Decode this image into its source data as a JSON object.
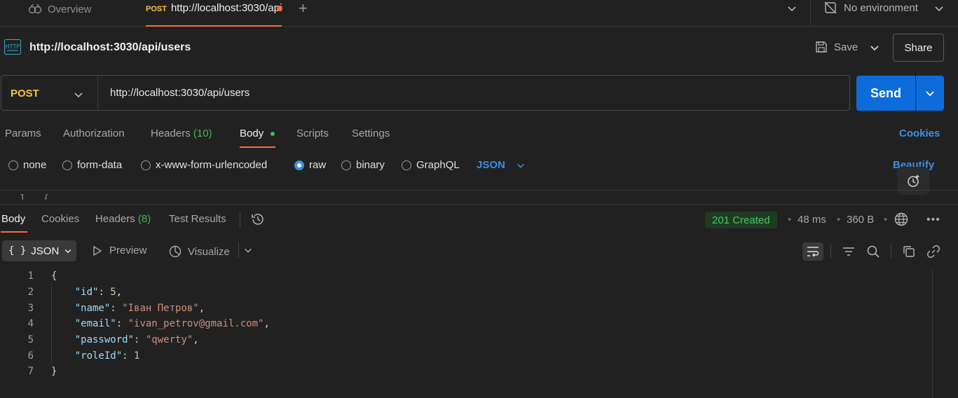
{
  "tabs": {
    "overview_label": "Overview",
    "active": {
      "method": "POST",
      "label": "http://localhost:3030/api/users"
    },
    "environment": "No environment"
  },
  "request": {
    "title": "http://localhost:3030/api/users",
    "save_label": "Save",
    "share_label": "Share",
    "method": "POST",
    "url": "http://localhost:3030/api/users",
    "send_label": "Send",
    "tabs": [
      {
        "label": "Params"
      },
      {
        "label": "Authorization"
      },
      {
        "label": "Headers",
        "count": "(10)"
      },
      {
        "label": "Body"
      },
      {
        "label": "Scripts"
      },
      {
        "label": "Settings"
      }
    ],
    "cookies_label": "Cookies",
    "body_types": [
      "none",
      "form-data",
      "x-www-form-urlencoded",
      "raw",
      "binary",
      "GraphQL"
    ],
    "selected_body_type": "raw",
    "body_format": "JSON",
    "beautify_label": "Beautify",
    "editor_first_line_number": "1",
    "editor_first_line_text": "{"
  },
  "response": {
    "tabs": [
      {
        "label": "Body"
      },
      {
        "label": "Cookies"
      },
      {
        "label": "Headers",
        "count": "(8)"
      },
      {
        "label": "Test Results"
      }
    ],
    "status": "201 Created",
    "time": "48 ms",
    "size": "360 B",
    "format_label": "JSON",
    "preview_label": "Preview",
    "visualize_label": "Visualize",
    "lines": [
      {
        "n": "1",
        "text": "{"
      },
      {
        "n": "2",
        "key": "\"id\"",
        "value": "5",
        "kind": "num"
      },
      {
        "n": "3",
        "key": "\"name\"",
        "value": "\"Іван Петров\"",
        "kind": "str"
      },
      {
        "n": "4",
        "key": "\"email\"",
        "value": "\"ivan_petrov@gmail.com\"",
        "kind": "str"
      },
      {
        "n": "5",
        "key": "\"password\"",
        "value": "\"qwerty\"",
        "kind": "str"
      },
      {
        "n": "6",
        "key": "\"roleId\"",
        "value": "1",
        "kind": "num",
        "last": true
      },
      {
        "n": "7",
        "text": "}"
      }
    ]
  },
  "colors": {
    "accent": "#ff6c37",
    "method_post": "#f5c542",
    "primary": "#0d6cda",
    "link": "#3b8fe8",
    "success": "#49c463"
  }
}
